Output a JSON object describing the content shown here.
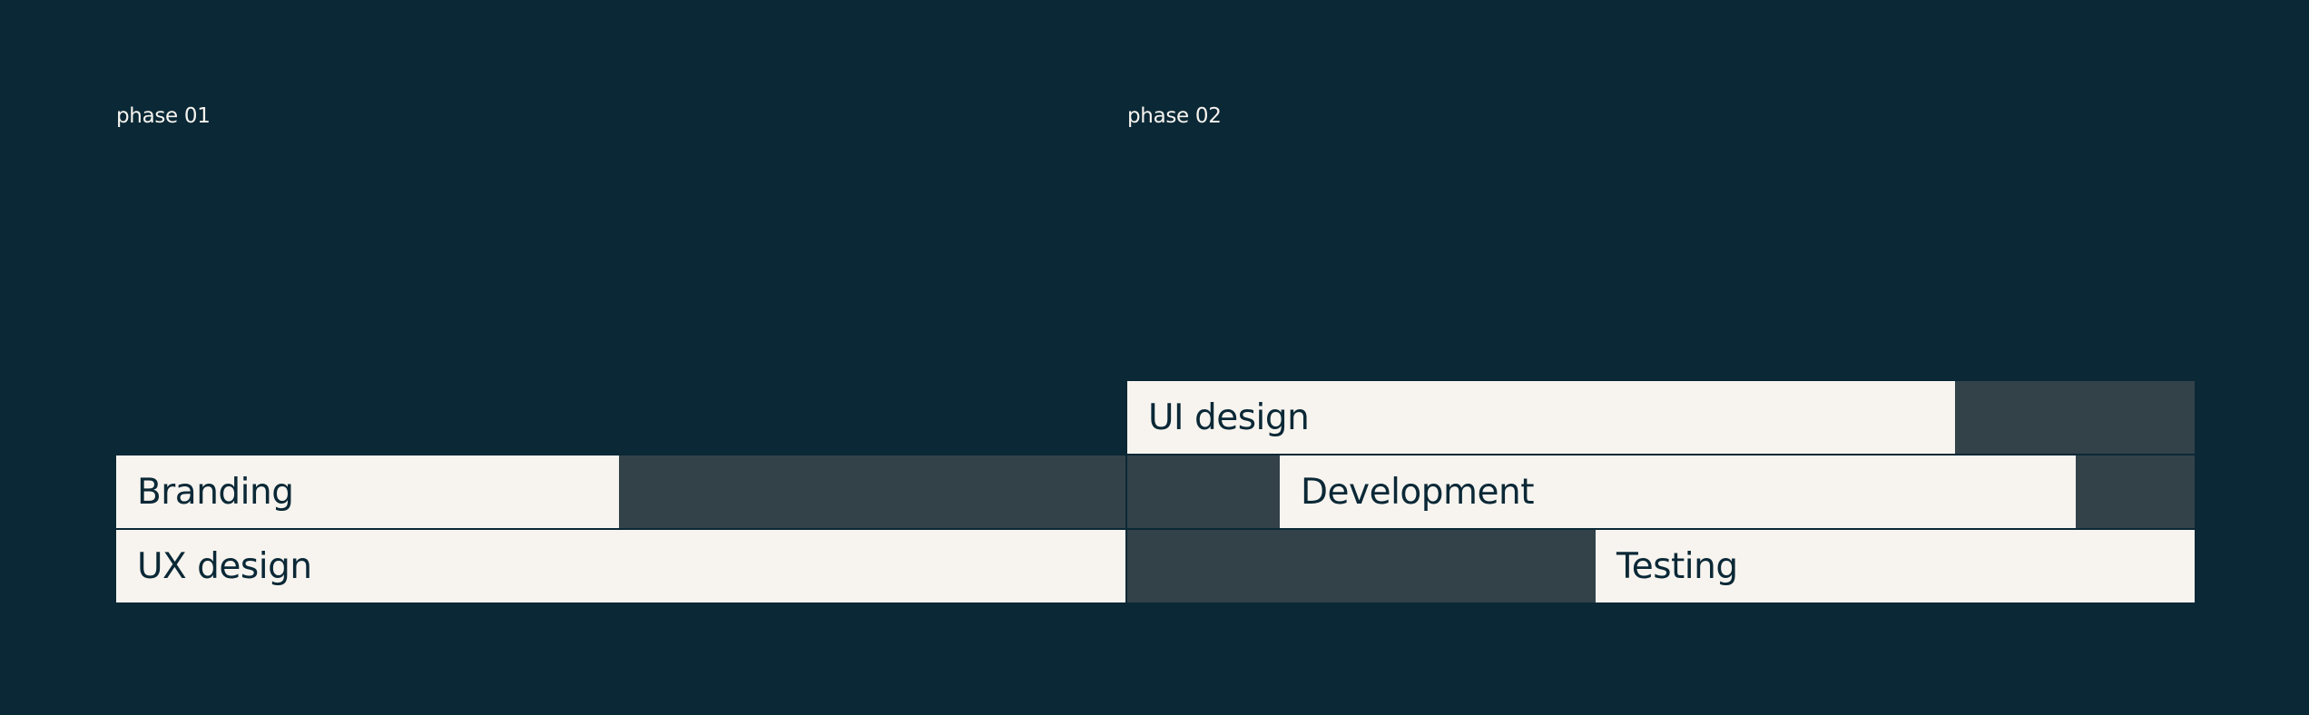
{
  "phases": [
    {
      "label": "phase 01"
    },
    {
      "label": "phase 02"
    }
  ],
  "tasks": [
    {
      "label": "UI design"
    },
    {
      "label": "Branding"
    },
    {
      "label": "Development"
    },
    {
      "label": "UX design"
    },
    {
      "label": "Testing"
    }
  ],
  "colors": {
    "background": "#0b2836",
    "bar": "#f7f4ef",
    "track": "#334249",
    "text_dark": "#0b2836",
    "text_light": "#f7f4ef"
  }
}
